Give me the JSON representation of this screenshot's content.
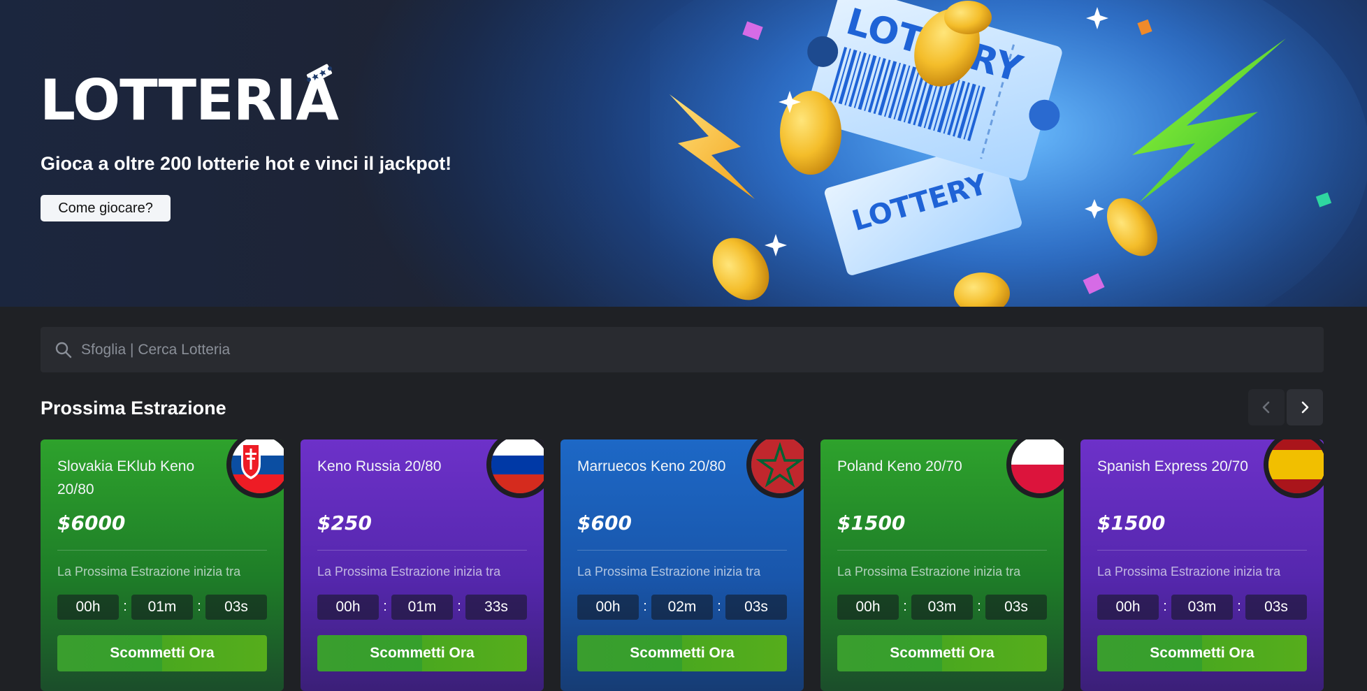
{
  "hero": {
    "title": "LOTTERIA",
    "subtitle": "Gioca a oltre 200 lotterie hot e vinci il jackpot!",
    "how_to_play": "Come giocare?",
    "art_text_1": "LOTTERY",
    "art_text_2": "LOTTERY"
  },
  "search": {
    "placeholder": "Sfoglia | Cerca Lotteria"
  },
  "section": {
    "title": "Prossima Estrazione"
  },
  "colors": {
    "green_card": "#2ea22c",
    "purple_card": "#6d31c9",
    "blue_card": "#1d68c6",
    "bet_button": "#3a9e2e"
  },
  "cards": [
    {
      "name": "Slovakia EKlub Keno 20/80",
      "prize": "$6000",
      "label": "La Prossima Estrazione inizia tra",
      "hours": "00h",
      "minutes": "01m",
      "seconds": "03s",
      "button": "Scommetti Ora",
      "flag": "slovakia-flag-icon"
    },
    {
      "name": "Keno Russia 20/80",
      "prize": "$250",
      "label": "La Prossima Estrazione inizia tra",
      "hours": "00h",
      "minutes": "01m",
      "seconds": "33s",
      "button": "Scommetti Ora",
      "flag": "russia-flag-icon"
    },
    {
      "name": "Marruecos Keno 20/80",
      "prize": "$600",
      "label": "La Prossima Estrazione inizia tra",
      "hours": "00h",
      "minutes": "02m",
      "seconds": "03s",
      "button": "Scommetti Ora",
      "flag": "morocco-flag-icon"
    },
    {
      "name": "Poland Keno 20/70",
      "prize": "$1500",
      "label": "La Prossima Estrazione inizia tra",
      "hours": "00h",
      "minutes": "03m",
      "seconds": "03s",
      "button": "Scommetti Ora",
      "flag": "poland-flag-icon"
    },
    {
      "name": "Spanish Express 20/70",
      "prize": "$1500",
      "label": "La Prossima Estrazione inizia tra",
      "hours": "00h",
      "minutes": "03m",
      "seconds": "03s",
      "button": "Scommetti Ora",
      "flag": "spain-flag-icon"
    }
  ],
  "separator": ":"
}
